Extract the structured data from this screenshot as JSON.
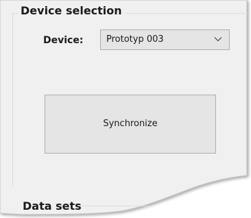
{
  "device_selection": {
    "title": "Device selection",
    "device_label": "Device:",
    "device_value": "Prototyp 003",
    "dropdown_icon": "chevron-down-icon",
    "synchronize_label": "Synchronize"
  },
  "data_sets": {
    "title": "Data sets"
  },
  "colors": {
    "window_background": "#f0f0f0",
    "control_background": "#e5e5e5",
    "control_border": "#adadad",
    "group_border": "#dcdcdc",
    "text": "#1a1a1a"
  }
}
